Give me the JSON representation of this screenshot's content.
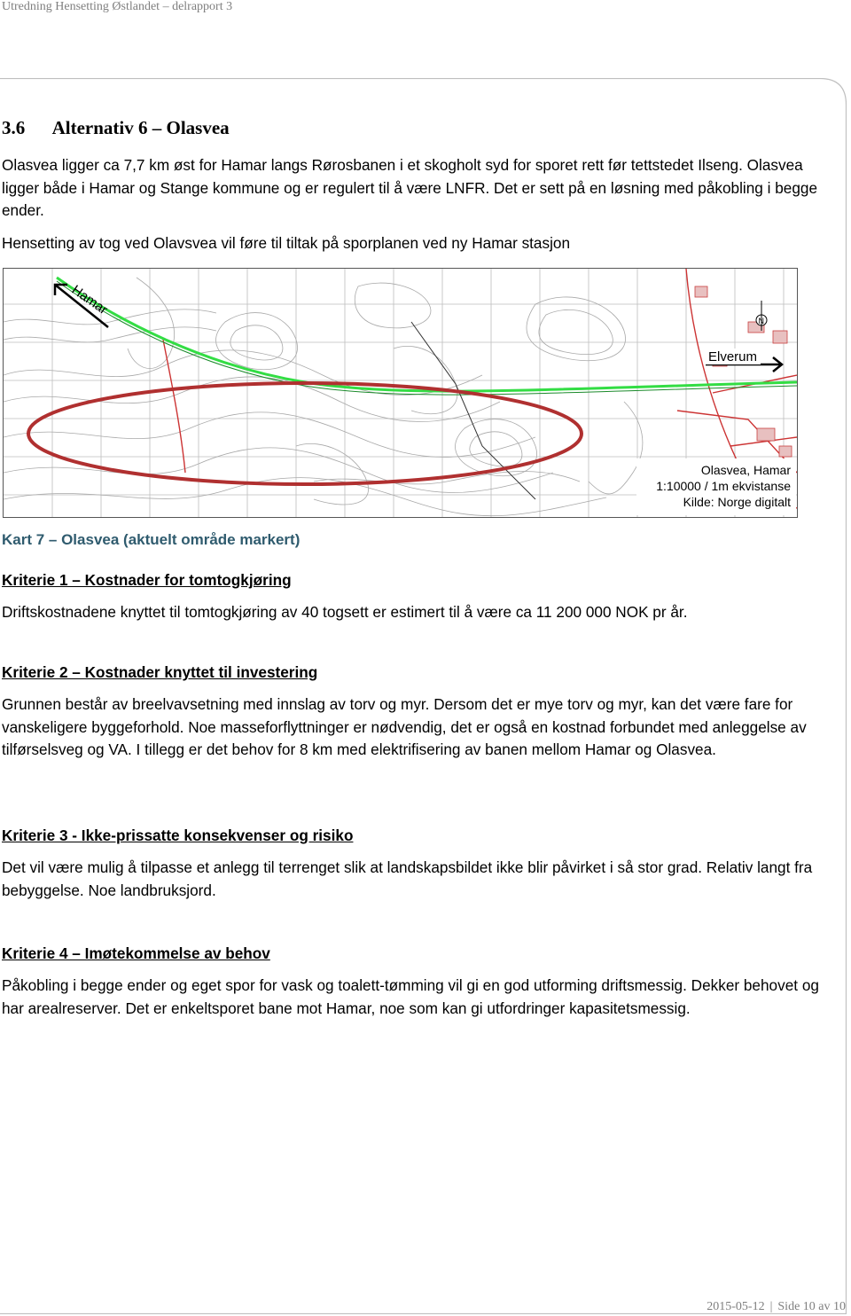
{
  "header": {
    "running_title": "Utredning Hensetting Østlandet – delrapport 3"
  },
  "section": {
    "number": "3.6",
    "title": "Alternativ 6 – Olasvea"
  },
  "intro": {
    "paragraph": "Olasvea ligger ca 7,7 km øst for Hamar langs Rørosbanen i et skogholt syd for sporet rett før tettstedet Ilseng. Olasvea ligger både i Hamar og Stange kommune og er regulert til å være LNFR. Det er sett på en løsning med påkobling i begge ender.",
    "note": "Hensetting av tog ved Olavsvea vil føre til tiltak på sporplanen ved ny Hamar stasjon"
  },
  "map": {
    "label_west": "Hamar",
    "label_east": "Elverum",
    "legend_title": "Olasvea, Hamar",
    "legend_scale": "1:10000 / 1m ekvistanse",
    "legend_source": "Kilde: Norge digitalt",
    "colors": {
      "track": "#33dd44",
      "highlight": "#b03030",
      "contour": "#b0b0b0",
      "roads": "#cc3333"
    }
  },
  "map_caption": "Kart 7 – Olasvea (aktuelt område markert)",
  "criteria": [
    {
      "heading": "Kriterie 1 – Kostnader for tomtogkjøring",
      "text": "Driftskostnadene knyttet til tomtogkjøring av 40 togsett er estimert til å være ca 11 200 000 NOK pr år."
    },
    {
      "heading": "Kriterie 2 – Kostnader knyttet til investering",
      "text": "Grunnen består av breelvavsetning med innslag av torv og myr. Dersom det er mye torv og myr, kan det være fare for vanskeligere byggeforhold.  Noe masseforflyttninger er nødvendig, det er også en kostnad forbundet med anleggelse av tilførselsveg og VA. I tillegg er det behov for 8 km med elektrifisering av banen mellom Hamar og Olasvea."
    },
    {
      "heading": "Kriterie 3 - Ikke-prissatte konsekvenser og risiko",
      "text": "Det vil være mulig å tilpasse et anlegg til terrenget slik at landskapsbildet ikke blir påvirket i så stor grad. Relativ langt fra bebyggelse. Noe landbruksjord."
    },
    {
      "heading": "Kriterie 4 – Imøtekommelse av behov",
      "text": "Påkobling i begge ender og eget spor for vask og toalett-tømming vil gi en god utforming driftsmessig. Dekker behovet og har arealreserver. Det er enkeltsporet bane mot Hamar, noe som kan gi utfordringer kapasitetsmessig."
    }
  ],
  "footer": {
    "date": "2015-05-12",
    "page": "Side 10 av 10"
  }
}
